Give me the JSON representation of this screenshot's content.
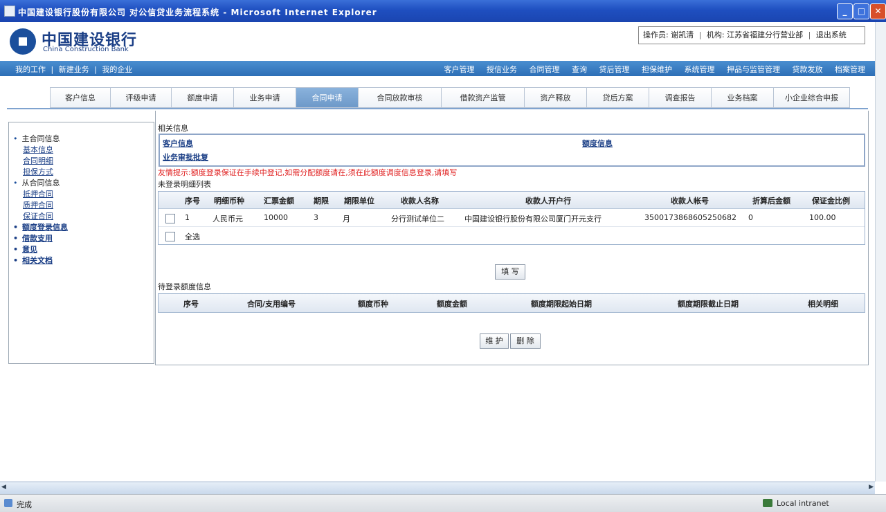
{
  "window": {
    "title": "中国建设银行股份有限公司 对公信贷业务流程系统 - Microsoft Internet Explorer",
    "btn_min": "_",
    "btn_max": "□",
    "btn_close": "✕"
  },
  "header": {
    "logo_cn": "中国建设银行",
    "logo_en": "China Construction Bank",
    "user_label": "操作员: 谢凯清",
    "org_label": "机构: 江苏省福建分行营业部",
    "logout": "退出系统",
    "sep": "|"
  },
  "nav": {
    "left": [
      "我的工作",
      "|",
      "新建业务",
      "|",
      "我的企业"
    ],
    "right": [
      "客户管理",
      "授信业务",
      "合同管理",
      "查询",
      "贷后管理",
      "担保维护",
      "系统管理",
      "押品与监管管理",
      "贷款发放",
      "档案管理"
    ]
  },
  "tabs": [
    {
      "label": "客户信息"
    },
    {
      "label": "评级申请"
    },
    {
      "label": "额度申请"
    },
    {
      "label": "业务申请"
    },
    {
      "label": "合同申请",
      "active": true
    },
    {
      "label": "合同放款审核"
    },
    {
      "label": "借款资产监管"
    },
    {
      "label": "资产释放"
    },
    {
      "label": "贷后方案"
    },
    {
      "label": "调查报告"
    },
    {
      "label": "业务档案"
    },
    {
      "label": "小企业综合申报"
    }
  ],
  "tree": {
    "main_contract": "主合同信息",
    "main_subs": [
      "基本信息",
      "合同明细",
      "担保方式"
    ],
    "sub_contract": "从合同信息",
    "sub_subs": [
      "抵押合同",
      "质押合同",
      "保证合同"
    ],
    "links": [
      "额度登录信息",
      "借款支用",
      "意见",
      "相关文档"
    ]
  },
  "main": {
    "related_title": "相关信息",
    "link_customer": "客户信息",
    "link_limit": "额度信息",
    "link_approval": "业务审批批复",
    "warning": "友情提示:额度登录保证在手续中登记,如需分配额度请在,须在此额度调度信息登录,请填写",
    "unregistered_title": "未登录明细列表",
    "registered_title": "待登录额度信息",
    "fill_btn": "填 写",
    "maintain_btn": "维 护",
    "delete_btn": "删 除"
  },
  "table1": {
    "headers": [
      "序号",
      "明细币种",
      "汇票金额",
      "期限",
      "期限单位",
      "收款人名称",
      "收款人开户行",
      "收款人帐号",
      "折算后金额",
      "保证金比例"
    ],
    "row": [
      "1",
      "人民币元",
      "10000",
      "3",
      "月",
      "分行测试单位二",
      "中国建设银行股份有限公司厦门开元支行",
      "3500173868605250682",
      "0",
      "100.00"
    ],
    "select_all": "全选"
  },
  "table2": {
    "headers": [
      "序号",
      "合同/支用编号",
      "额度币种",
      "额度金额",
      "额度期限起始日期",
      "额度期限截止日期",
      "相关明细"
    ]
  },
  "status": {
    "text": "完成",
    "zone": "Local intranet"
  }
}
